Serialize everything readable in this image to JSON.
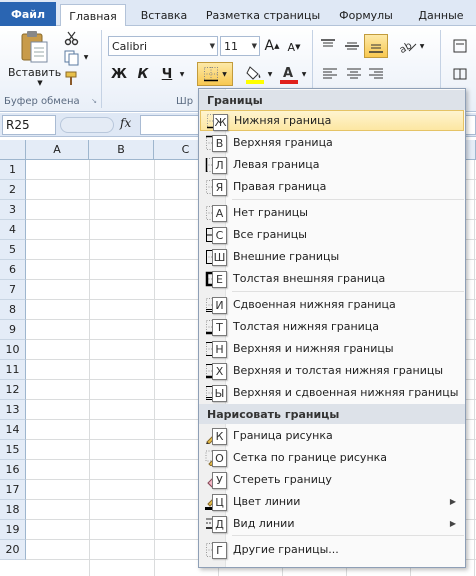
{
  "ribbon_tabs": {
    "file": "Файл",
    "home": "Главная",
    "insert": "Вставка",
    "page_layout": "Разметка страницы",
    "formulas": "Формулы",
    "data": "Данные"
  },
  "clipboard": {
    "paste_label": "Вставить",
    "group_label": "Буфер обмена"
  },
  "font": {
    "name": "Calibri",
    "size": "11",
    "bold": "Ж",
    "italic": "К",
    "underline": "Ч",
    "grow": "A",
    "shrink": "A",
    "group_label": "Шр"
  },
  "name_box": "R25",
  "fx_label": "fx",
  "columns": [
    "A",
    "B",
    "C"
  ],
  "rows": [
    "1",
    "2",
    "3",
    "4",
    "5",
    "6",
    "7",
    "8",
    "9",
    "10",
    "11",
    "12",
    "13",
    "14",
    "15",
    "16",
    "17",
    "18",
    "19",
    "20"
  ],
  "menu": {
    "borders_header": "Границы",
    "draw_header": "Нарисовать границы",
    "items": [
      {
        "label": "Нижняя граница",
        "key": "Ж"
      },
      {
        "label": "Верхняя граница",
        "key": "В"
      },
      {
        "label": "Левая граница",
        "key": "Л"
      },
      {
        "label": "Правая граница",
        "key": "Я"
      },
      {
        "label": "Нет границы",
        "key": "А"
      },
      {
        "label": "Все границы",
        "key": "С"
      },
      {
        "label": "Внешние границы",
        "key": "Ш"
      },
      {
        "label": "Толстая внешняя граница",
        "key": "Е"
      },
      {
        "label": "Сдвоенная нижняя граница",
        "key": "И"
      },
      {
        "label": "Толстая нижняя граница",
        "key": "Т"
      },
      {
        "label": "Верхняя и нижняя границы",
        "key": "Н"
      },
      {
        "label": "Верхняя и толстая нижняя границы",
        "key": "Х"
      },
      {
        "label": "Верхняя и сдвоенная нижняя границы",
        "key": "Ы"
      }
    ],
    "draw_items": [
      {
        "label": "Граница рисунка",
        "key": "К"
      },
      {
        "label": "Сетка по границе рисунка",
        "key": "О"
      },
      {
        "label": "Стереть границу",
        "key": "У"
      },
      {
        "label": "Цвет линии",
        "key": "Ц"
      },
      {
        "label": "Вид линии",
        "key": "Д"
      },
      {
        "label": "Другие границы...",
        "key": "Г"
      }
    ]
  },
  "colors": {
    "file_tab": "#2a65b2",
    "ribbon_bg": "#dfe8f5",
    "highlight": "#fde7a2",
    "font_color_red": "#e0201b",
    "fill_yellow": "#ffff00"
  }
}
